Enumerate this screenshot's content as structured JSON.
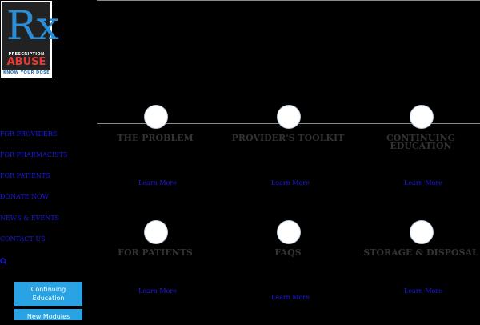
{
  "logo": {
    "rx": "Rx",
    "line1": "PRESCRIPTION",
    "line2": "ABUSE",
    "tagline": "KNOW YOUR DOSE"
  },
  "nav": [
    {
      "label": "FOR PROVIDERS"
    },
    {
      "label": "FOR PHARMACISTS"
    },
    {
      "label": "FOR PATIENTS"
    },
    {
      "label": "DONATE NOW"
    },
    {
      "label": "NEWS & EVENTS"
    },
    {
      "label": "CONTACT US"
    }
  ],
  "sidebar_buttons": [
    {
      "label": "Continuing Education"
    },
    {
      "label": "New Modules"
    }
  ],
  "cards": [
    {
      "title": "THE PROBLEM",
      "link": "Learn More"
    },
    {
      "title": "PROVIDER'S TOOLKIT",
      "link": "Learn More"
    },
    {
      "title": "CONTINUING EDUCATION",
      "link": "Learn More"
    },
    {
      "title": "FOR PATIENTS",
      "link": "Learn More"
    },
    {
      "title": "FAQS",
      "link": "Learn More"
    },
    {
      "title": "STORAGE & DISPOSAL",
      "link": "Learn More"
    }
  ],
  "colors": {
    "background": "#000000",
    "link": "#1a1ae6",
    "button": "#29a3e3",
    "title": "#333333"
  },
  "icons": {
    "search": "search-icon"
  }
}
